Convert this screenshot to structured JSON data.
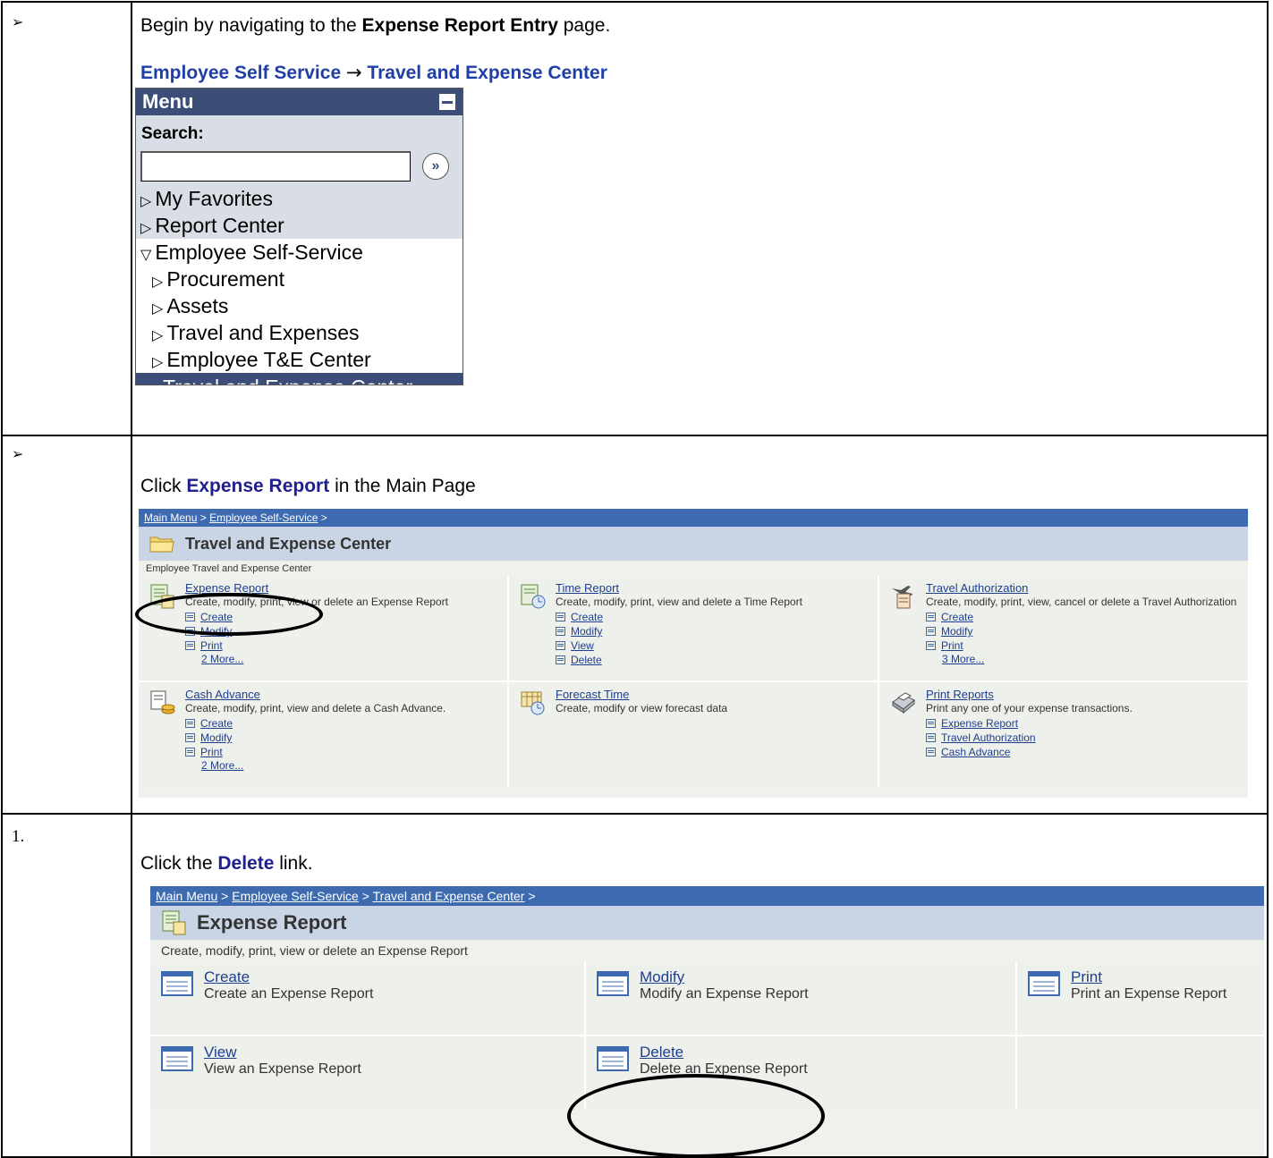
{
  "rows": [
    {
      "marker": "➢",
      "instruction_pre": "Begin by navigating to the ",
      "instruction_bold": "Expense Report Entry",
      "instruction_post": " page.",
      "nav_from": "Employee Self Service",
      "nav_arrow": "→",
      "nav_to": "Travel and Expense Center"
    },
    {
      "marker": "➢",
      "instruction_pre": "Click ",
      "instruction_bold": "Expense Report",
      "instruction_post": " in the Main Page"
    },
    {
      "marker": "1.",
      "instruction_pre": "Click the ",
      "instruction_bold": "Delete",
      "instruction_post": "  link."
    }
  ],
  "menu": {
    "title": "Menu",
    "search_label": "Search:",
    "search_value": "",
    "go_glyph": "»",
    "items": [
      {
        "label": "My Favorites",
        "state": "collapsed"
      },
      {
        "label": "Report Center",
        "state": "collapsed"
      },
      {
        "label": "Employee Self-Service",
        "state": "expanded"
      },
      {
        "label": "Procurement",
        "state": "collapsed"
      },
      {
        "label": "Assets",
        "state": "collapsed"
      },
      {
        "label": "Travel and Expenses",
        "state": "collapsed"
      },
      {
        "label": "Employee T&E Center",
        "state": "collapsed"
      },
      {
        "label": "Travel and Expense Center",
        "state": "selected"
      }
    ]
  },
  "te_center": {
    "breadcrumb": [
      "Main Menu",
      "Employee Self-Service"
    ],
    "title": "Travel and Expense Center",
    "subtitle": "Employee Travel and Expense Center",
    "tiles": [
      {
        "title": "Expense Report",
        "desc": "Create, modify, print, view or delete an Expense Report",
        "links": [
          "Create",
          "Modify",
          "Print"
        ],
        "more": "2 More..."
      },
      {
        "title": "Time Report",
        "desc": "Create, modify, print, view and delete a Time Report",
        "links": [
          "Create",
          "Modify",
          "View",
          "Delete"
        ],
        "more": ""
      },
      {
        "title": "Travel Authorization",
        "desc": "Create, modify, print, view, cancel or delete a Travel Authorization",
        "links": [
          "Create",
          "Modify",
          "Print"
        ],
        "more": "3 More..."
      },
      {
        "title": "Cash Advance",
        "desc": "Create, modify, print, view and delete a Cash Advance.",
        "links": [
          "Create",
          "Modify",
          "Print"
        ],
        "more": "2 More..."
      },
      {
        "title": "Forecast Time",
        "desc": "Create, modify or view forecast data",
        "links": [],
        "more": ""
      },
      {
        "title": "Print Reports",
        "desc": "Print any one of your expense transactions.",
        "links": [
          "Expense Report",
          "Travel Authorization",
          "Cash Advance"
        ],
        "more": ""
      }
    ]
  },
  "expense_report": {
    "breadcrumb": [
      "Main Menu",
      "Employee Self-Service",
      "Travel and Expense Center"
    ],
    "title": "Expense Report",
    "subtitle": "Create, modify, print, view or delete an Expense Report",
    "tiles": [
      {
        "title": "Create",
        "desc": "Create an Expense Report"
      },
      {
        "title": "Modify",
        "desc": "Modify an Expense Report"
      },
      {
        "title": "Print",
        "desc": "Print an Expense Report"
      },
      {
        "title": "View",
        "desc": "View an Expense Report"
      },
      {
        "title": "Delete",
        "desc": "Delete an Expense Report"
      }
    ]
  },
  "colors": {
    "menu_header": "#3c4d77",
    "breadcrumb_bar": "#3e6ab0",
    "title_band": "#c9d5e5",
    "link": "#1c3f8f",
    "instruction_bold": "#1f1f8f"
  }
}
